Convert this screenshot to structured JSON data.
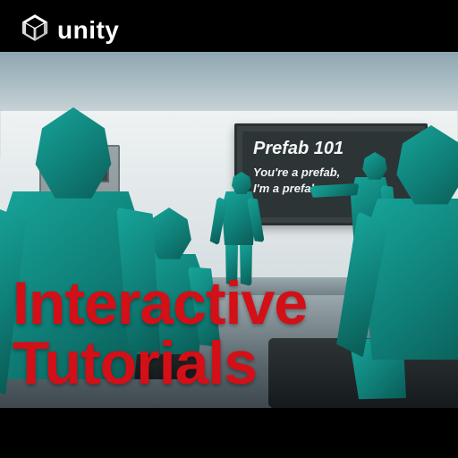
{
  "brand": {
    "name": "unity"
  },
  "board": {
    "title": "Prefab 101",
    "line1": "You're a prefab,",
    "line2": "I'm a prefab..."
  },
  "headline": {
    "line1": "Interactive",
    "line2": "Tutorials"
  },
  "colors": {
    "teal": "#17a59a",
    "headline": "#d30f17"
  }
}
